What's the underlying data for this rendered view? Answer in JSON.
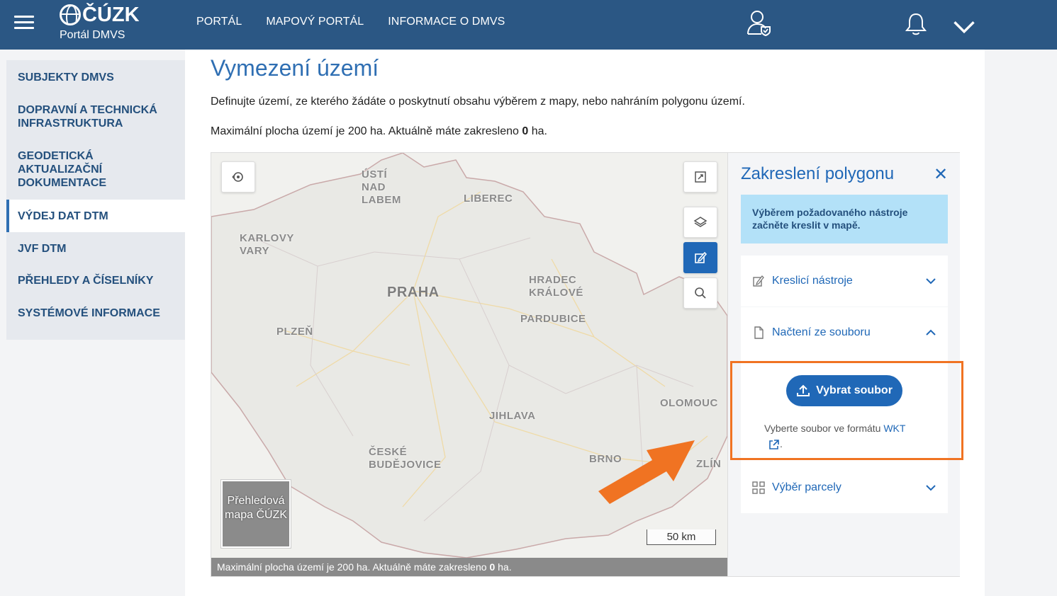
{
  "header": {
    "logo_text": "ČÚZK",
    "logo_sub": "Portál DMVS",
    "nav": [
      "PORTÁL",
      "MAPOVÝ PORTÁL",
      "INFORMACE O DMVS"
    ],
    "icons": [
      "menu-icon",
      "user-icon",
      "bell-icon",
      "chevron-down-icon"
    ]
  },
  "sidebar": {
    "items": [
      {
        "label": "SUBJEKTY DMVS"
      },
      {
        "label": "DOPRAVNÍ A TECHNICKÁ INFRASTRUKTURA"
      },
      {
        "label": "GEODETICKÁ AKTUALIZAČNÍ DOKUMENTACE"
      },
      {
        "label": "VÝDEJ DAT DTM",
        "active": true
      },
      {
        "label": "JVF DTM"
      },
      {
        "label": "PŘEHLEDY A ČÍSELNÍKY"
      },
      {
        "label": "SYSTÉMOVÉ INFORMACE"
      }
    ]
  },
  "main": {
    "title": "Vymezení území",
    "desc1": "Definujte území, ze kterého žádáte o poskytnutí obsahu výběrem z mapy, nebo nahráním polygonu území.",
    "desc2_prefix": "Maximální plocha území je 200 ha. Aktuálně máte zakresleno ",
    "desc2_value": "0",
    "desc2_suffix": " ha."
  },
  "map": {
    "cities": [
      "ÚSTÍ NAD LABEM",
      "LIBEREC",
      "KARLOVY VARY",
      "PRAHA",
      "HRADEC KRÁLOVÉ",
      "PARDUBICE",
      "PLZEŇ",
      "JIHLAVA",
      "OLOMOUC",
      "ČESKÉ BUDĚJOVICE",
      "BRNO",
      "ZLÍN"
    ],
    "overview_label": "Přehledová mapa ČÚZK",
    "scale": "50 km",
    "status_prefix": "Maximální plocha území je 200 ha. Aktuálně máte zakresleno ",
    "status_value": "0",
    "status_suffix": " ha."
  },
  "panel": {
    "title": "Zakreslení polygonu",
    "close": "✕",
    "info": "Výběrem požadovaného nástroje začněte kreslit v mapě.",
    "accordion": [
      {
        "label": "Kreslicí nástroje",
        "icon": "pencil-icon",
        "expanded": false
      },
      {
        "label": "Načtení ze souboru",
        "icon": "file-icon",
        "expanded": true
      },
      {
        "label": "Výběr parcely",
        "icon": "grid-icon",
        "expanded": false
      }
    ],
    "upload_label": "Vybrat soubor",
    "file_hint_prefix": "Vyberte soubor ve formátu ",
    "file_hint_link": "WKT",
    "file_hint_suffix": "."
  },
  "colors": {
    "header": "#2b5784",
    "accent": "#2068b7",
    "highlight": "#f07322"
  }
}
